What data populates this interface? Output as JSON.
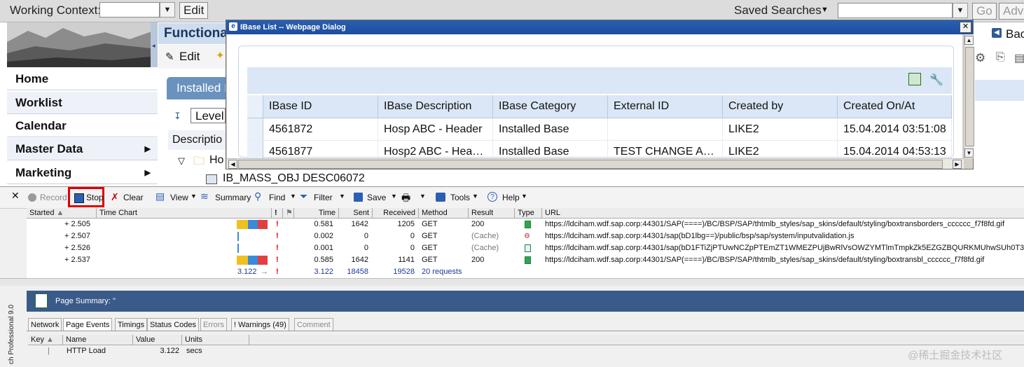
{
  "topbar": {
    "working_context_label": "Working Context:",
    "working_context_value": "",
    "edit_button": "Edit",
    "saved_searches_label": "Saved Searches",
    "search_value": "",
    "go_button": "Go",
    "advanced_button": "Adv"
  },
  "nav": {
    "items": [
      {
        "label": "Home"
      },
      {
        "label": "Worklist"
      },
      {
        "label": "Calendar"
      },
      {
        "label": "Master Data"
      },
      {
        "label": "Marketing"
      }
    ]
  },
  "main": {
    "title": "Functiona",
    "edit_label": "Edit",
    "tab_installed": "Installed I",
    "level_label": "Level",
    "description_label": "Descriptio",
    "tree_node": "Ho",
    "object_label": "IB_MASS_OBJ DESC06072",
    "back_label": "Bac"
  },
  "dialog": {
    "title": "IBase List -- Webpage Dialog",
    "columns": [
      "IBase ID",
      "IBase Description",
      "IBase Category",
      "External ID",
      "Created by",
      "Created On/At"
    ],
    "rows": [
      [
        "4561872",
        "Hosp ABC - Header",
        "Installed Base",
        "",
        "LIKE2",
        "15.04.2014 03:51:08"
      ],
      [
        "4561877",
        "Hosp2 ABC - Hea…",
        "Installed Base",
        "TEST CHANGE A…",
        "LIKE2",
        "15.04.2014 04:53:13"
      ]
    ]
  },
  "fiddler": {
    "toolbar": {
      "record": "Record",
      "stop": "Stop",
      "clear": "Clear",
      "view": "View",
      "summary": "Summary",
      "find": "Find",
      "filter": "Filter",
      "save": "Save",
      "tools": "Tools",
      "help": "Help"
    },
    "columns": [
      "Started",
      "Time Chart",
      "!",
      "",
      "Time",
      "Sent",
      "Received",
      "Method",
      "Result",
      "Type",
      "URL"
    ],
    "rows": [
      {
        "started": "+ 2.505",
        "time": "0.581",
        "sent": "1642",
        "received": "1205",
        "method": "GET",
        "result": "200",
        "url": "https://ldciham.wdf.sap.corp:44301/SAP(====)/BC/BSP/SAP/thtmlb_styles/sap_skins/default/styling/boxtransborders_cccccc_f7f8fd.gif"
      },
      {
        "started": "+ 2.507",
        "time": "0.002",
        "sent": "0",
        "received": "0",
        "method": "GET",
        "result": "(Cache)",
        "url": "https://ldciham.wdf.sap.corp:44301/sap(bD1lbg==)/public/bsp/sap/system/inputvalidation.js"
      },
      {
        "started": "+ 2.526",
        "time": "0.001",
        "sent": "0",
        "received": "0",
        "method": "GET",
        "result": "(Cache)",
        "url": "https://ldciham.wdf.sap.corp:44301/sap(bD1FTiZjPTUwNCZpPTEmZT1WMEZPUjBwRlVsOWZYMTlmTmpkZk5EZGZBQURKMUhwSUh0T3h2WXp4C"
      },
      {
        "started": "+ 2.537",
        "time": "0.585",
        "sent": "1642",
        "received": "1141",
        "method": "GET",
        "result": "200",
        "url": "https://ldciham.wdf.sap.corp:44301/SAP(====)/BC/BSP/SAP/thtmlb_styles/sap_skins/default/styling/boxtransbl_cccccc_f7f8fd.gif"
      }
    ],
    "totals": {
      "chart": "3.122",
      "time": "3.122",
      "sent": "18458",
      "received": "19528",
      "requests": "20 requests"
    },
    "page_summary": "Page Summary: ''",
    "tabs": [
      "Network",
      "Page Events",
      "Timings",
      "Status Codes",
      "Errors",
      "! Warnings (49)",
      "Comment"
    ],
    "kv_columns": [
      "Key",
      "Name",
      "Value",
      "Units"
    ],
    "kv_rows": [
      {
        "key": "",
        "name": "HTTP Load",
        "value": "3.122",
        "units": "secs"
      }
    ],
    "side_label": "ch Professional 9.0"
  },
  "watermark": "@稀土掘金技术社区"
}
